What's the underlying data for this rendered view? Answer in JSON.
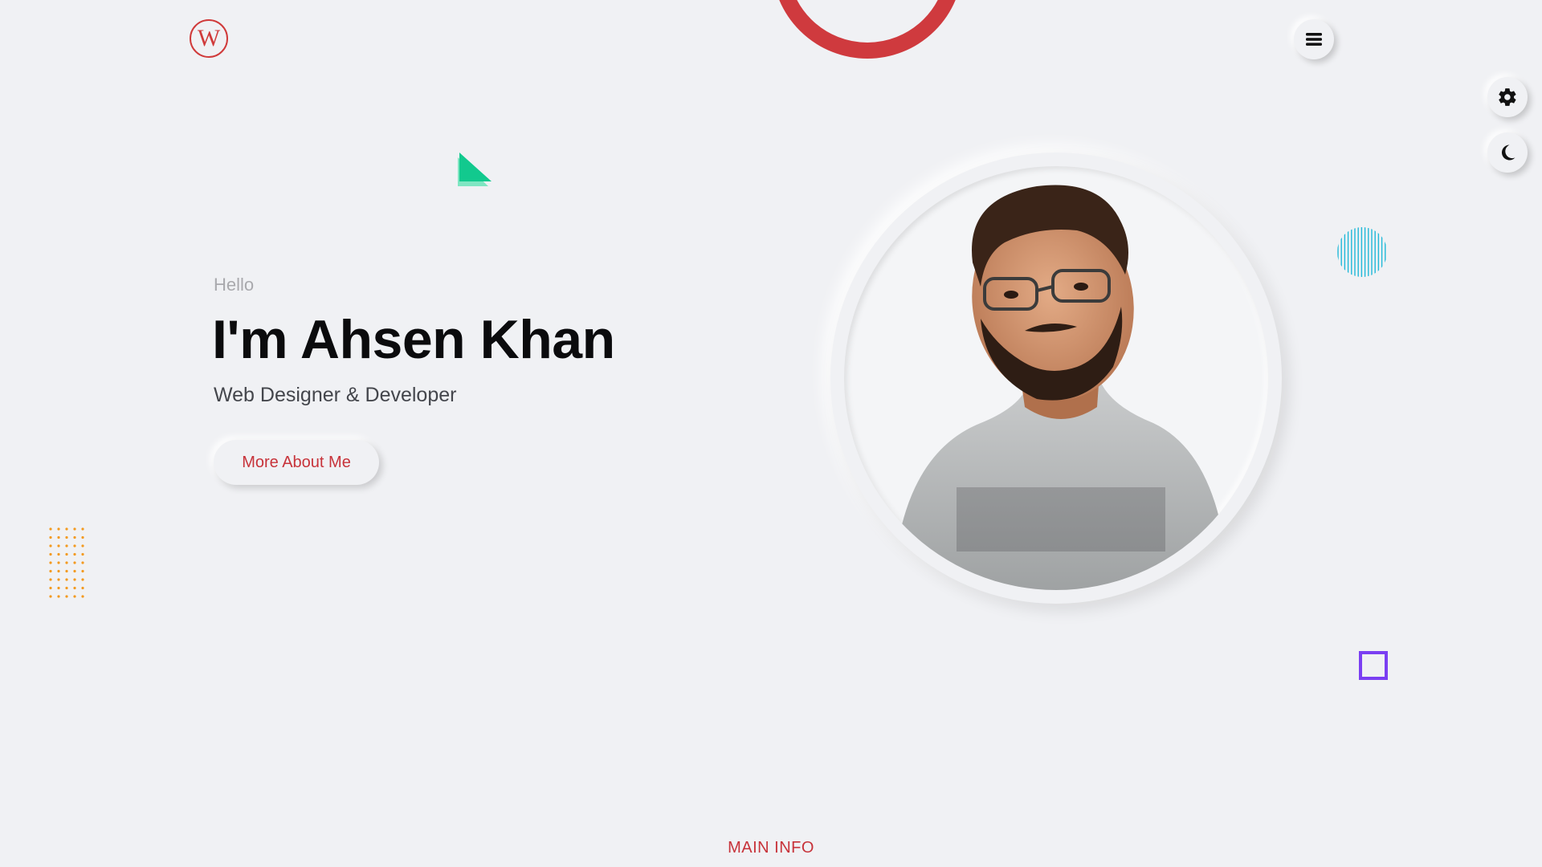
{
  "brand": {
    "logo_letter": "W",
    "accent_color": "#cf3a3e"
  },
  "header": {
    "menu_icon": "hamburger-menu-icon"
  },
  "side_controls": {
    "settings_icon": "gear-icon",
    "theme_icon": "moon-icon"
  },
  "hero": {
    "greeting": "Hello",
    "name": "I'm Ahsen Khan",
    "role": "Web Designer & Developer",
    "cta_label": "More About Me",
    "portrait_icon": "profile-photo"
  },
  "sections": {
    "next_label": "MAIN INFO"
  },
  "colors": {
    "background": "#f0f1f4",
    "triangle": "#12c98e",
    "dots": "#f39a1f",
    "lines_circle": "#1fb8d8",
    "square": "#7b3ff2"
  }
}
